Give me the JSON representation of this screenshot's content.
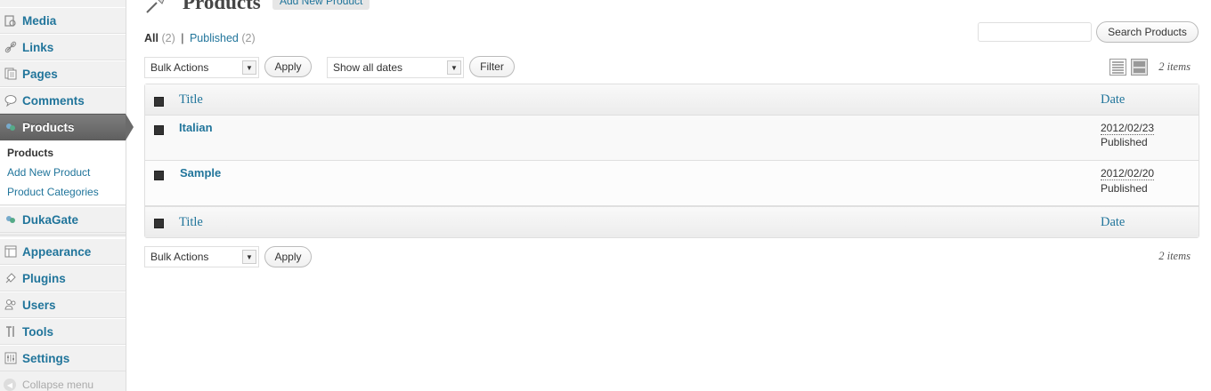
{
  "sidebar": {
    "items": [
      {
        "label": "Media",
        "icon": "media-icon"
      },
      {
        "label": "Links",
        "icon": "links-icon"
      },
      {
        "label": "Pages",
        "icon": "pages-icon"
      },
      {
        "label": "Comments",
        "icon": "comments-icon"
      },
      {
        "label": "Products",
        "icon": "products-icon"
      },
      {
        "label": "DukaGate",
        "icon": "dukagate-icon"
      },
      {
        "label": "Appearance",
        "icon": "appearance-icon"
      },
      {
        "label": "Plugins",
        "icon": "plugins-icon"
      },
      {
        "label": "Users",
        "icon": "users-icon"
      },
      {
        "label": "Tools",
        "icon": "tools-icon"
      },
      {
        "label": "Settings",
        "icon": "settings-icon"
      }
    ],
    "submenu": [
      "Products",
      "Add New Product",
      "Product Categories"
    ],
    "collapse_label": "Collapse menu"
  },
  "header": {
    "title": "Products",
    "add_new_label": "Add New Product"
  },
  "filters": {
    "all_label": "All",
    "all_count": "(2)",
    "separator": "|",
    "published_label": "Published",
    "published_count": "(2)"
  },
  "search": {
    "button_label": "Search Products",
    "value": ""
  },
  "actions": {
    "bulk_actions": "Bulk Actions",
    "apply_label": "Apply",
    "dates_filter": "Show all dates",
    "filter_label": "Filter",
    "items_count": "2 items"
  },
  "table": {
    "columns": [
      "Title",
      "Date"
    ],
    "rows": [
      {
        "title": "Italian",
        "date": "2012/02/23",
        "status": "Published"
      },
      {
        "title": "Sample",
        "date": "2012/02/20",
        "status": "Published"
      }
    ]
  },
  "colors": {
    "link": "#21759b",
    "current_menu_bg": "#6b6b6b"
  }
}
